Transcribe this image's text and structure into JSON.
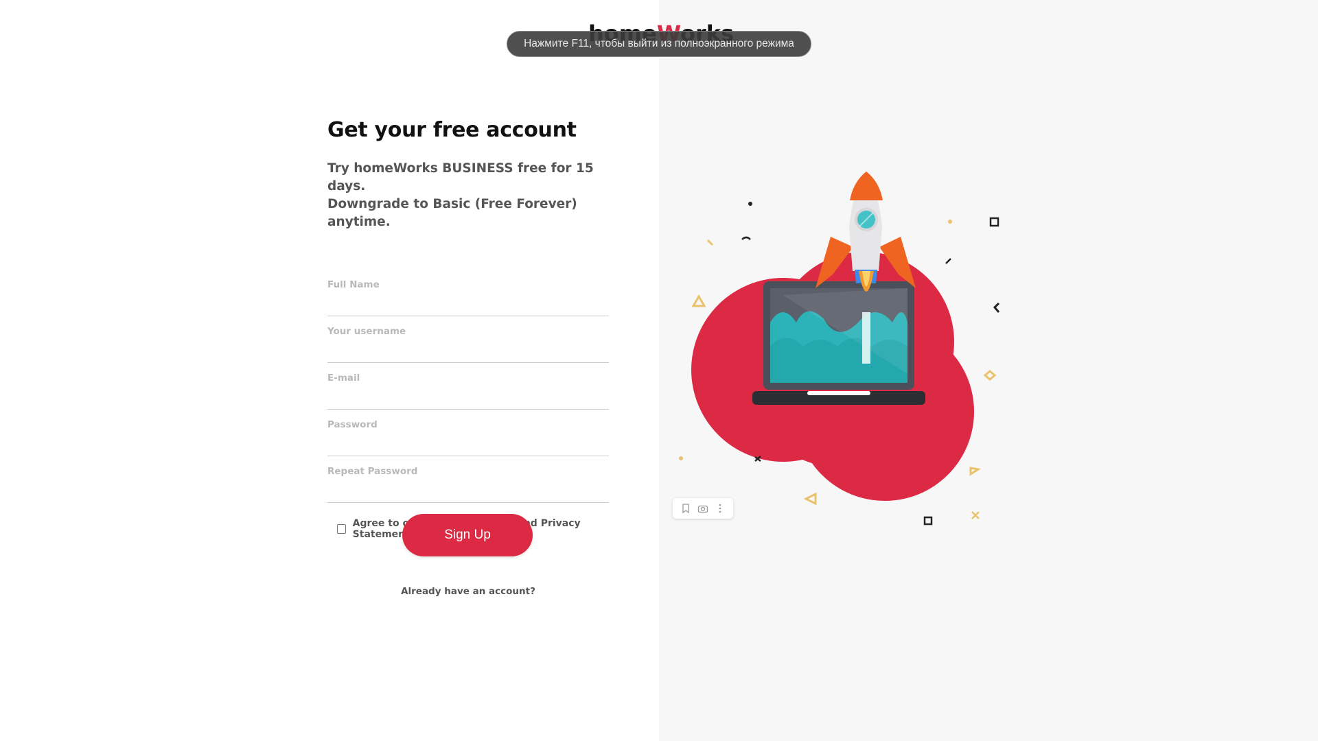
{
  "brand": {
    "logo_prefix": "home",
    "logo_accent": "W",
    "logo_suffix": "orks",
    "accent_color": "#dc2a45"
  },
  "fullscreen_toast": "Нажмите F11, чтобы выйти из полноэкранного режима",
  "form": {
    "title": "Get your free account",
    "subtitle_line1": "Try homeWorks BUSINESS free for 15 days.",
    "subtitle_line2": "Downgrade to Basic (Free Forever) anytime.",
    "fields": [
      {
        "placeholder": "Full Name",
        "value": ""
      },
      {
        "placeholder": "Your username",
        "value": ""
      },
      {
        "placeholder": "E-mail",
        "value": ""
      },
      {
        "placeholder": "Password",
        "value": ""
      },
      {
        "placeholder": "Repeat Password",
        "value": ""
      }
    ],
    "agree_label": "Agree to our Terms of Service and Privacy Statement",
    "agree_checked": false,
    "submit_label": "Sign Up",
    "login_link": "Already have an account?"
  },
  "illustration": {
    "icons": [
      "rocket",
      "laptop",
      "clouds",
      "confetti"
    ]
  },
  "mini_toolbar": {
    "icons": [
      "bookmark-icon",
      "camera-icon",
      "more-icon"
    ]
  }
}
